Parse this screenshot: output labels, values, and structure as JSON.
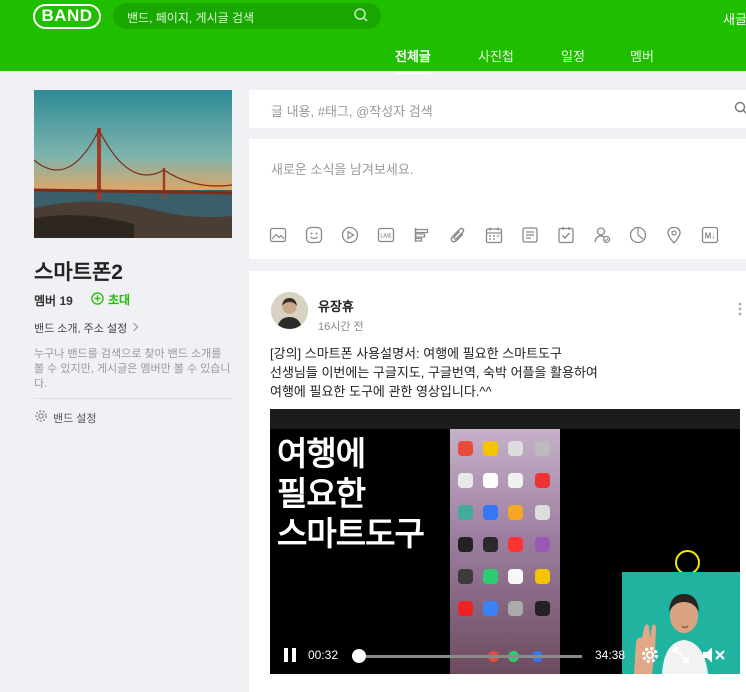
{
  "header": {
    "logo": "BAND",
    "search_placeholder": "밴드, 페이지, 게시글 검색",
    "right_text": "새글"
  },
  "tabs": [
    {
      "label": "전체글",
      "active": true
    },
    {
      "label": "사진첩",
      "active": false
    },
    {
      "label": "일정",
      "active": false
    },
    {
      "label": "멤버",
      "active": false
    }
  ],
  "sidebar": {
    "band_name": "스마트폰2",
    "members_label": "멤버",
    "members_count": "19",
    "invite_label": "초대",
    "about_label": "밴드 소개, 주소 설정",
    "description": "누구나 밴드를 검색으로 찾아 밴드 소개를 볼 수 있지만, 게시글은 멤버만 볼 수 있습니다.",
    "settings_label": "밴드 설정"
  },
  "main": {
    "post_search_placeholder": "글 내용, #태그, @작성자 검색",
    "compose_placeholder": "새로운 소식을 남겨보세요.",
    "toolbar_icons": [
      "photo-icon",
      "emoji-icon",
      "video-icon",
      "live-icon",
      "poll-icon",
      "attach-icon",
      "calendar-icon",
      "todo-icon",
      "checklist-icon",
      "attendance-icon",
      "timer-icon",
      "location-icon",
      "markdown-icon"
    ]
  },
  "post": {
    "author": "유장휴",
    "time": "16시간 전",
    "body_lines": [
      "[강의] 스마트폰 사용설명서: 여행에 필요한 스마트도구",
      "선생님들 이번에는 구글지도, 구글번역, 숙박 어플을 활용하여",
      "여행에 필요한 도구에 관한 영상입니다.^^"
    ],
    "video": {
      "title_lines": [
        "여행에",
        "필요한",
        "스마트도구"
      ],
      "current_time": "00:32",
      "duration": "34:38",
      "progress": 0.015
    }
  },
  "colors": {
    "brand_green": "#1fbf00",
    "background": "#eff1f4"
  }
}
